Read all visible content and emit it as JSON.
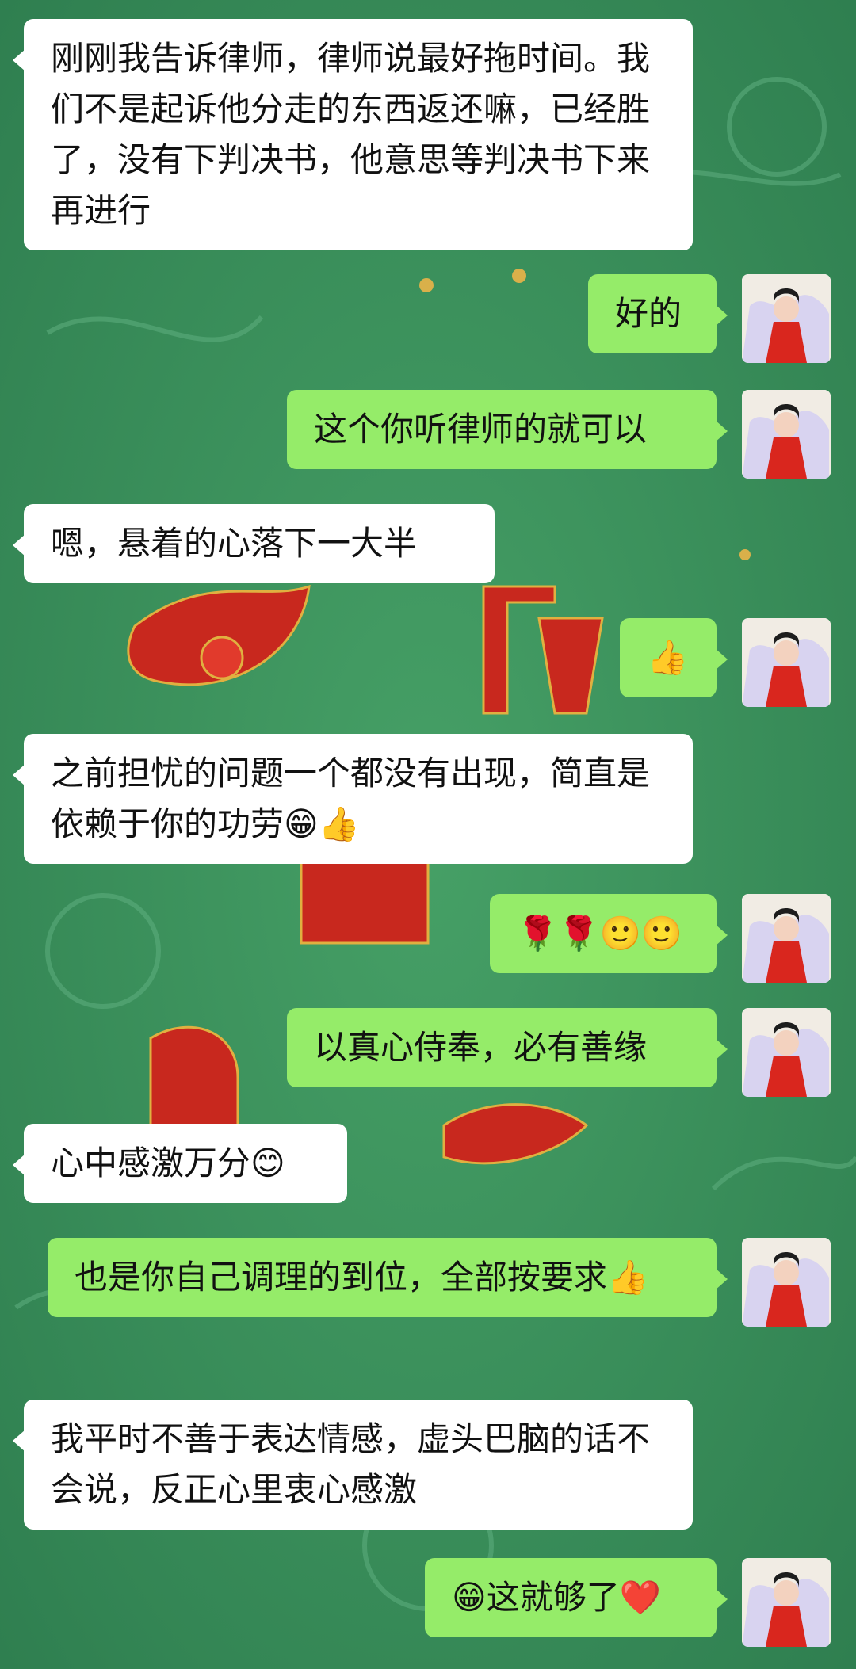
{
  "messages": [
    {
      "side": "in",
      "text": "刚刚我告诉律师，律师说最好拖时间。我们不是起诉他分走的东西返还嘛，已经胜了，没有下判决书，他意思等判决书下来再进行"
    },
    {
      "side": "out",
      "text": "好的"
    },
    {
      "side": "out",
      "text": "这个你听律师的就可以"
    },
    {
      "side": "in",
      "text": "嗯，悬着的心落下一大半"
    },
    {
      "side": "out",
      "text": "👍"
    },
    {
      "side": "in",
      "text": "之前担忧的问题一个都没有出现，简直是依赖于你的功劳😁👍"
    },
    {
      "side": "out",
      "text": "🌹🌹🙂🙂"
    },
    {
      "side": "out",
      "text": "以真心侍奉，必有善缘"
    },
    {
      "side": "in",
      "text": "心中感激万分😊"
    },
    {
      "side": "out",
      "text": "也是你自己调理的到位，全部按要求👍"
    },
    {
      "side": "in",
      "text": "我平时不善于表达情感，虚头巴脑的话不会说，反正心里衷心感激"
    },
    {
      "side": "out",
      "text": "😁这就够了❤️"
    }
  ],
  "colors": {
    "background": "#3c8f5c",
    "incoming_bubble": "#ffffff",
    "outgoing_bubble": "#95ec69",
    "pattern_red": "#c8281e"
  }
}
